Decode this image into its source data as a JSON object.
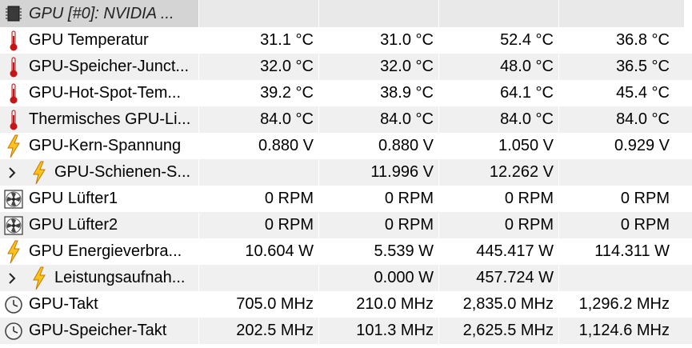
{
  "header": {
    "label": "GPU [#0]: NVIDIA ..."
  },
  "rows": [
    {
      "label": "GPU Temperatur",
      "icon": "thermometer-icon",
      "values": [
        "31.1 °C",
        "31.0 °C",
        "52.4 °C",
        "36.8 °C"
      ]
    },
    {
      "label": "GPU-Speicher-Junct...",
      "icon": "thermometer-icon",
      "values": [
        "32.0 °C",
        "32.0 °C",
        "48.0 °C",
        "36.5 °C"
      ]
    },
    {
      "label": "GPU-Hot-Spot-Tem...",
      "icon": "thermometer-icon",
      "values": [
        "39.2 °C",
        "38.9 °C",
        "64.1 °C",
        "45.4 °C"
      ]
    },
    {
      "label": "Thermisches GPU-Li...",
      "icon": "thermometer-icon",
      "values": [
        "84.0 °C",
        "84.0 °C",
        "84.0 °C",
        "84.0 °C"
      ]
    },
    {
      "label": "GPU-Kern-Spannung",
      "icon": "lightning-icon",
      "values": [
        "0.880 V",
        "0.880 V",
        "1.050 V",
        "0.929 V"
      ]
    },
    {
      "label": "GPU-Schienen-S...",
      "icon": "lightning-icon",
      "expandable": true,
      "values": [
        "",
        "11.996 V",
        "12.262 V",
        ""
      ]
    },
    {
      "label": "GPU Lüfter1",
      "icon": "fan-icon",
      "values": [
        "0 RPM",
        "0 RPM",
        "0 RPM",
        "0 RPM"
      ]
    },
    {
      "label": "GPU Lüfter2",
      "icon": "fan-icon",
      "values": [
        "0 RPM",
        "0 RPM",
        "0 RPM",
        "0 RPM"
      ]
    },
    {
      "label": "GPU Energieverbra...",
      "icon": "lightning-icon",
      "values": [
        "10.604 W",
        "5.539 W",
        "445.417 W",
        "114.311 W"
      ]
    },
    {
      "label": "Leistungsaufnah...",
      "icon": "lightning-icon",
      "expandable": true,
      "values": [
        "",
        "0.000 W",
        "457.724 W",
        ""
      ]
    },
    {
      "label": "GPU-Takt",
      "icon": "clock-icon",
      "values": [
        "705.0 MHz",
        "210.0 MHz",
        "2,835.0 MHz",
        "1,296.2 MHz"
      ]
    },
    {
      "label": "GPU-Speicher-Takt",
      "icon": "clock-icon",
      "values": [
        "202.5 MHz",
        "101.3 MHz",
        "2,625.5 MHz",
        "1,124.6 MHz"
      ]
    }
  ]
}
